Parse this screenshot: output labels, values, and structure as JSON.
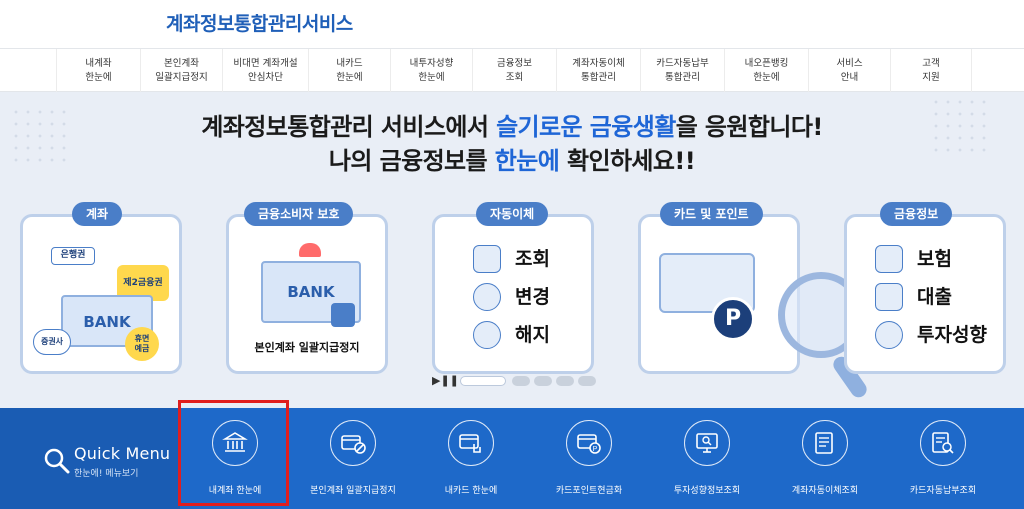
{
  "header": {
    "title": "계좌정보통합관리서비스"
  },
  "nav": {
    "items": [
      "내계좌\n한눈에",
      "본인계좌\n일괄지급정지",
      "비대면 계좌개설\n안심차단",
      "내카드\n한눈에",
      "내투자성향\n한눈에",
      "금융정보\n조회",
      "계좌자동이체\n통합관리",
      "카드자동납부\n통합관리",
      "내오픈뱅킹\n한눈에",
      "서비스\n안내",
      "고객\n지원"
    ]
  },
  "hero": {
    "line1_a": "계좌정보통합관리 서비스에서 ",
    "line1_hl": "슬기로운 금융생활",
    "line1_b": "을 응원합니다!",
    "line2_a": "나의 금융정보를 ",
    "line2_hl": "한눈에",
    "line2_b": " 확인하세요!!",
    "cards": {
      "account": {
        "label": "계좌",
        "tags": [
          "은행권",
          "제2금융권",
          "BANK",
          "증권사",
          "휴면\n예금"
        ]
      },
      "protection": {
        "label": "금융소비자 보호",
        "bank": "BANK",
        "caption": "본인계좌 일괄지급정지"
      },
      "autopay": {
        "label": "자동이체",
        "items": [
          "조회",
          "변경",
          "해지"
        ]
      },
      "card": {
        "label": "카드 및 포인트",
        "badge": "P"
      },
      "info": {
        "label": "금융정보",
        "items": [
          "보험",
          "대출",
          "투자성향"
        ]
      }
    },
    "slider": {
      "controls": "▶❚❚"
    }
  },
  "quick_menu": {
    "title": "Quick Menu",
    "subtitle": "한눈에! 메뉴보기",
    "items": [
      "내계좌 한눈에",
      "본인계좌 일괄지급정지",
      "내카드 한눈에",
      "카드포인트현금화",
      "투자성향정보조회",
      "계좌자동이체조회",
      "카드자동납부조회"
    ]
  },
  "colors": {
    "brand": "#1f5fb8",
    "accent": "#1f66d6",
    "quick_bg": "#1e69c9",
    "highlight": "#e01e1e"
  }
}
